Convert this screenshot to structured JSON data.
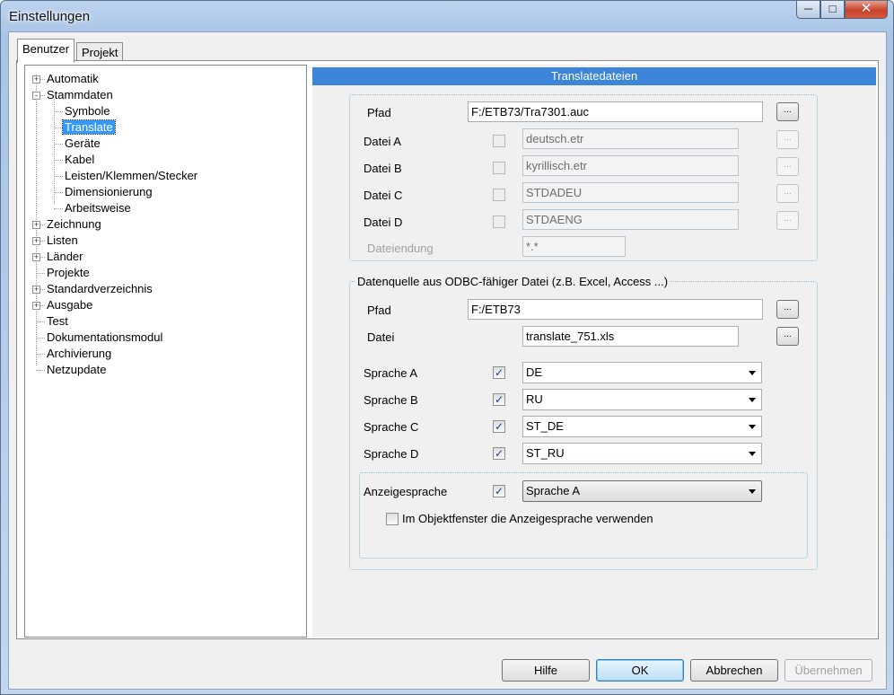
{
  "window": {
    "title": "Einstellungen",
    "minimize_icon": "minimize-icon",
    "maximize_icon": "maximize-icon",
    "close_icon": "close-icon"
  },
  "tabs": [
    {
      "label": "Benutzer",
      "active": true
    },
    {
      "label": "Projekt",
      "active": false
    }
  ],
  "tree": {
    "items": [
      {
        "label": "Automatik",
        "expander": "+"
      },
      {
        "label": "Stammdaten",
        "expander": "-"
      },
      {
        "label": "Symbole"
      },
      {
        "label": "Translate",
        "selected": true
      },
      {
        "label": "Geräte"
      },
      {
        "label": "Kabel"
      },
      {
        "label": "Leisten/Klemmen/Stecker"
      },
      {
        "label": "Dimensionierung"
      },
      {
        "label": "Arbeitsweise"
      },
      {
        "label": "Zeichnung",
        "expander": "+"
      },
      {
        "label": "Listen",
        "expander": "+"
      },
      {
        "label": "Länder",
        "expander": "+"
      },
      {
        "label": "Projekte"
      },
      {
        "label": "Standardverzeichnis",
        "expander": "+"
      },
      {
        "label": "Ausgabe",
        "expander": "+"
      },
      {
        "label": "Test"
      },
      {
        "label": "Dokumentationsmodul"
      },
      {
        "label": "Archivierung"
      },
      {
        "label": "Netzupdate"
      }
    ]
  },
  "content": {
    "header": "Translatedateien",
    "translate_group": {
      "pfad_label": "Pfad",
      "pfad_value": "F:/ETB73/Tra7301.auc",
      "browse_label": "...",
      "datei_a_label": "Datei A",
      "datei_a_value": "deutsch.etr",
      "datei_b_label": "Datei B",
      "datei_b_value": "kyrillisch.etr",
      "datei_c_label": "Datei C",
      "datei_c_value": "STDADEU",
      "datei_d_label": "Datei D",
      "datei_d_value": "STDAENG",
      "dateiendung_label": "Dateiendung",
      "dateiendung_value": "*.*"
    },
    "odbc_group": {
      "title": "Datenquelle aus ODBC-fähiger Datei (z.B. Excel, Access ...)",
      "pfad_label": "Pfad",
      "pfad_value": "F:/ETB73",
      "datei_label": "Datei",
      "datei_value": "translate_751.xls",
      "browse_label": "...",
      "sprache_a_label": "Sprache A",
      "sprache_a_value": "DE",
      "sprache_b_label": "Sprache B",
      "sprache_b_value": "RU",
      "sprache_c_label": "Sprache C",
      "sprache_c_value": "ST_DE",
      "sprache_d_label": "Sprache D",
      "sprache_d_value": "ST_RU",
      "anzeigesprache_label": "Anzeigesprache",
      "anzeigesprache_value": "Sprache A",
      "objektfenster_label": "Im Objektfenster die Anzeigesprache verwenden"
    }
  },
  "buttons": {
    "hilfe": "Hilfe",
    "ok": "OK",
    "abbrechen": "Abbrechen",
    "uebernehmen": "Übernehmen"
  },
  "check_mark": "✓"
}
